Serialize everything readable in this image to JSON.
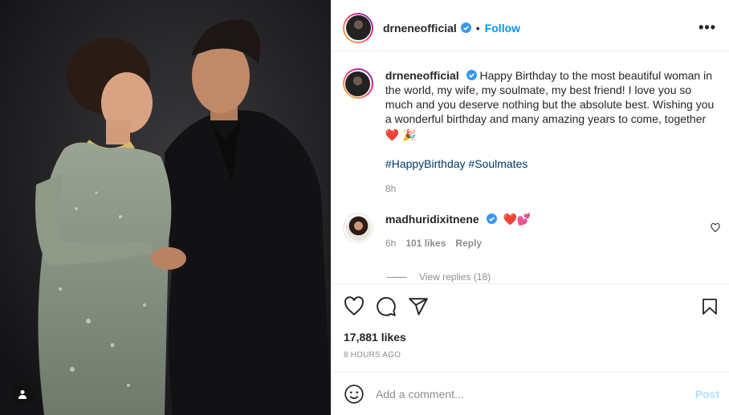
{
  "post": {
    "username": "drneneofficial",
    "follow_label": "Follow",
    "separator": "•",
    "more_label": "•••"
  },
  "caption": {
    "username": "drneneofficial",
    "text": "Happy Birthday to the most beautiful woman in the world, my wife, my soulmate, my best friend! I love you so much and you deserve nothing but the absolute best. Wishing you a wonderful birthday and many amazing years to come, together",
    "emoji": "❤️ 🎉",
    "hashtags": "#HappyBirthday #Soulmates",
    "time": "8h"
  },
  "comment": {
    "username": "madhuridixitnene",
    "text": "❤️💕",
    "time": "6h",
    "likes": "101 likes",
    "reply_label": "Reply",
    "view_replies": "View replies (18)"
  },
  "actions": {
    "like_icon": "heart-icon",
    "comment_icon": "comment-icon",
    "share_icon": "share-icon",
    "save_icon": "bookmark-icon"
  },
  "stats": {
    "likes": "17,881 likes",
    "posted": "8 HOURS AGO"
  },
  "composer": {
    "placeholder": "Add a comment...",
    "post_label": "Post"
  },
  "colors": {
    "accent": "#0095f6",
    "hashtag": "#00376b",
    "muted": "#8e8e8e",
    "post_disabled": "#b2dffc",
    "verified": "#3897f0"
  }
}
